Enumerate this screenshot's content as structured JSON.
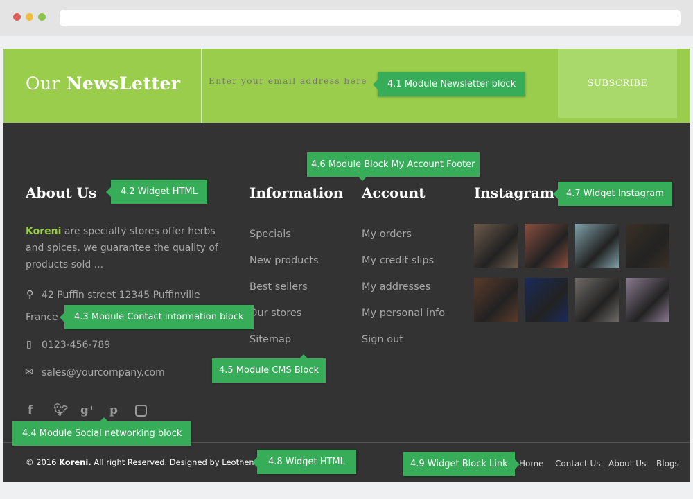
{
  "newsletter": {
    "title_light": "Our",
    "title_bold": "NewsLetter",
    "placeholder": "Enter your email address here",
    "button": "SUBSCRIBE"
  },
  "about": {
    "heading": "About Us",
    "brand": "Koreni",
    "description": " are specialty stores offer herbs and spices. we guarantee the quality of products sold ...",
    "address_line1": "42 Puffin street 12345 Puffinville",
    "address_line2": "France",
    "phone": "0123-456-789",
    "email": "sales@yourcompany.com"
  },
  "social": [
    "facebook",
    "twitter",
    "google-plus",
    "pinterest",
    "instagram"
  ],
  "information": {
    "heading": "Information",
    "items": [
      "Specials",
      "New products",
      "Best sellers",
      "Our stores",
      "Sitemap"
    ]
  },
  "account": {
    "heading": "Account",
    "items": [
      "My orders",
      "My credit slips",
      "My addresses",
      "My personal info",
      "Sign out"
    ]
  },
  "instagram": {
    "heading": "Instagram",
    "photo_colors": [
      "#6b5a4a",
      "#8a4e3e",
      "#7fa0a8",
      "#3a3026",
      "#5a3a2a",
      "#1a2a5a",
      "#6e6a66",
      "#8a7a90"
    ]
  },
  "footer": {
    "copyright_prefix": "© 2016 ",
    "brand": "Koreni.",
    "copyright_suffix": " All right Reserved. Designed by Leotheme",
    "links": [
      "Home",
      "Contact Us",
      "About Us",
      "Blogs"
    ]
  },
  "annotations": {
    "a41": "4.1 Module Newsletter block",
    "a42": "4.2 Widget HTML",
    "a43": "4.3 Module Contact information block",
    "a44": "4.4 Module Social networking block",
    "a45": "4.5 Module CMS Block",
    "a46": "4.6 Module Block My Account Footer",
    "a47": "4.7 Widget Instagram",
    "a48": "4.8 Widget HTML",
    "a49": "4.9 Widget Block Link"
  },
  "colors": {
    "accent": "#9acd4c",
    "footer_bg": "#333333",
    "annotation": "#37ad59"
  }
}
